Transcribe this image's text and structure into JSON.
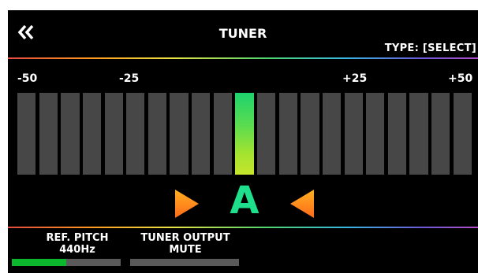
{
  "header": {
    "title": "TUNER",
    "type_label": "TYPE: [SELECT]",
    "back_icon": "double-chevron-left-icon"
  },
  "scale": {
    "minus50": "-50",
    "minus25": "-25",
    "plus25": "+25",
    "plus50": "+50"
  },
  "meter": {
    "segment_count": 21,
    "active_segment_index": 10,
    "cents_offset": 0
  },
  "note": {
    "name": "A",
    "left_indicator_icon": "triangle-right-icon",
    "right_indicator_icon": "triangle-left-icon"
  },
  "params": {
    "ref_pitch": {
      "label": "REF. PITCH",
      "value": "440Hz",
      "level": 0.5
    },
    "tuner_output": {
      "label": "TUNER OUTPUT",
      "value": "MUTE",
      "level": 0
    }
  },
  "colors": {
    "screen_bg": "#000000",
    "segment_off": "#474747",
    "segment_on": "#5bdc4f",
    "note_green": "#1ee08c",
    "indicator_orange": "#ff9a1f",
    "param_bar_fill": "#0bb82d",
    "param_bar_track": "#5a5a5a"
  }
}
